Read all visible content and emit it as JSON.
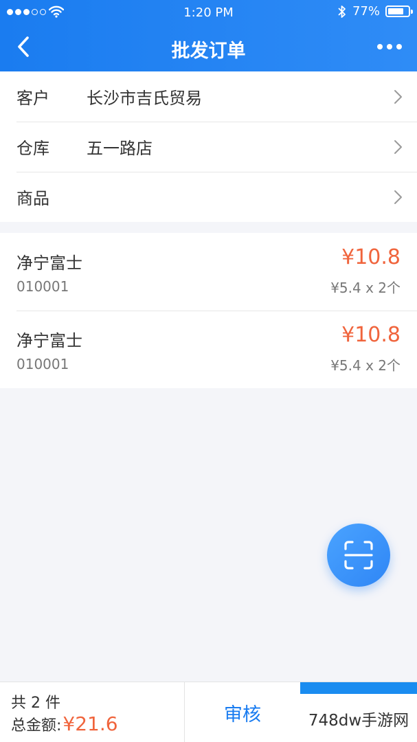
{
  "status_bar": {
    "time": "1:20 PM",
    "battery_percent": "77%",
    "battery_level": 0.77,
    "signal_bars": 3,
    "signal_total": 5
  },
  "nav": {
    "title": "批发订单",
    "back_icon": "chevron-left-icon",
    "more_icon": "more-horizontal-icon"
  },
  "form": {
    "customer": {
      "label": "客户",
      "value": "长沙市吉氏贸易"
    },
    "warehouse": {
      "label": "仓库",
      "value": "五一路店"
    },
    "goods": {
      "label": "商品",
      "value": ""
    }
  },
  "items": [
    {
      "name": "净宁富士",
      "code": "010001",
      "total": "¥10.8",
      "detail": "¥5.4 x 2个"
    },
    {
      "name": "净宁富士",
      "code": "010001",
      "total": "¥10.8",
      "detail": "¥5.4 x 2个"
    }
  ],
  "summary": {
    "count_text": "共 2 件",
    "total_label": "总金额:",
    "total_amount": "¥21.6"
  },
  "actions": {
    "audit_label": "审核"
  },
  "watermark": "748dw手游网",
  "colors": {
    "brand": "#1a7cf0",
    "price": "#f0643c",
    "background": "#f4f5f9"
  }
}
